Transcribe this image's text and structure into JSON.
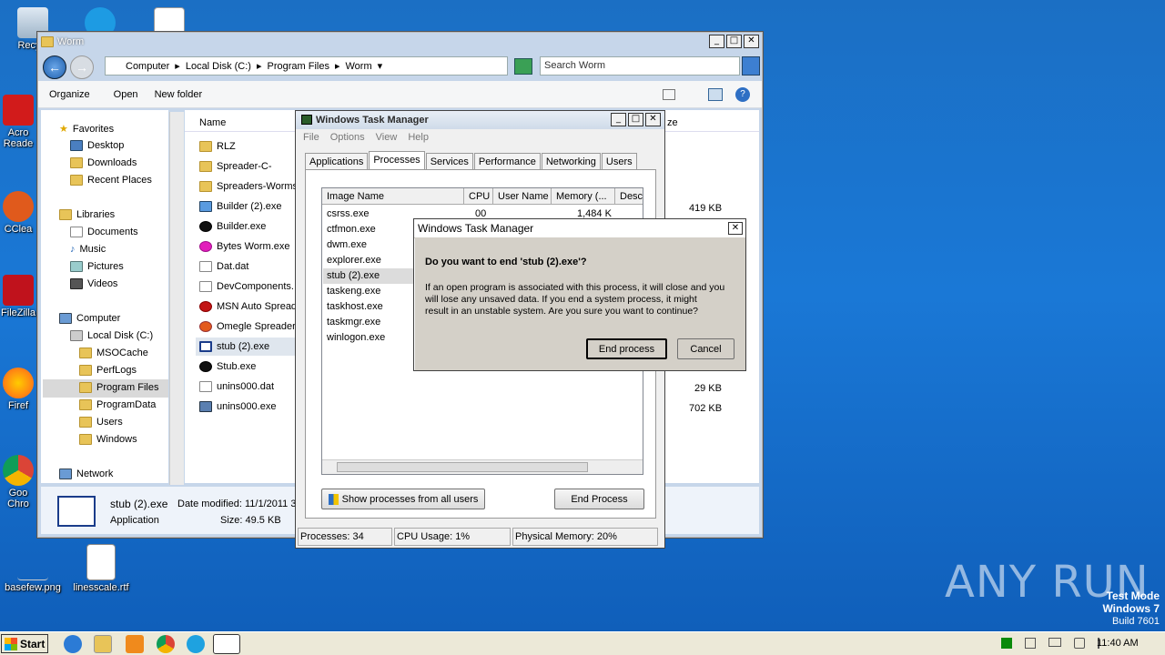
{
  "desktop": {
    "icons": {
      "recycle": "Recycl",
      "acrobat": "Acro Reade",
      "ccleaner": "CClea",
      "filezilla": "FileZilla",
      "firefox": "Firef",
      "chrome": "Goo Chro",
      "basefew": "basefew.png",
      "linesscale": "linesscale.rtf"
    },
    "watermark": "ANY RUN",
    "test_mode": {
      "line1": "Test Mode",
      "line2": "Windows 7",
      "line3": "Build 7601"
    }
  },
  "explorer": {
    "title": "Worm",
    "breadcrumbs": [
      "Computer",
      "Local Disk (C:)",
      "Program Files",
      "Worm"
    ],
    "search_placeholder": "Search Worm",
    "toolbar": {
      "organize": "Organize",
      "open": "Open",
      "new_folder": "New folder"
    },
    "column_name": "Name",
    "column_size": "ze",
    "nav": {
      "favorites": "Favorites",
      "desktop": "Desktop",
      "downloads": "Downloads",
      "recent": "Recent Places",
      "libraries": "Libraries",
      "documents": "Documents",
      "music": "Music",
      "pictures": "Pictures",
      "videos": "Videos",
      "computer": "Computer",
      "local_disk": "Local Disk (C:)",
      "msocache": "MSOCache",
      "perflogs": "PerfLogs",
      "program_files": "Program Files",
      "programdata": "ProgramData",
      "users": "Users",
      "windows": "Windows",
      "network": "Network"
    },
    "files": [
      {
        "name": "RLZ",
        "size": ""
      },
      {
        "name": "Spreader-C-",
        "size": ""
      },
      {
        "name": "Spreaders-Worms",
        "size": ""
      },
      {
        "name": "Builder (2).exe",
        "size": "419 KB"
      },
      {
        "name": "Builder.exe",
        "size": ""
      },
      {
        "name": "Bytes Worm.exe",
        "size": ""
      },
      {
        "name": "Dat.dat",
        "size": ""
      },
      {
        "name": "DevComponents.",
        "size": ""
      },
      {
        "name": "MSN Auto Spread",
        "size": ""
      },
      {
        "name": "Omegle Spreader",
        "size": ""
      },
      {
        "name": "stub (2).exe",
        "size": ""
      },
      {
        "name": "Stub.exe",
        "size": ""
      },
      {
        "name": "unins000.dat",
        "size": "29 KB"
      },
      {
        "name": "unins000.exe",
        "size": "702 KB"
      }
    ],
    "details": {
      "name": "stub (2).exe",
      "modified": "Date modified: 11/1/2011 3",
      "type": "Application",
      "size": "Size: 49.5 KB"
    }
  },
  "taskmgr": {
    "title": "Windows Task Manager",
    "menu": [
      "File",
      "Options",
      "View",
      "Help"
    ],
    "tabs": [
      "Applications",
      "Processes",
      "Services",
      "Performance",
      "Networking",
      "Users"
    ],
    "columns": [
      "Image Name",
      "CPU",
      "User Name",
      "Memory (...",
      "Desc"
    ],
    "processes": [
      {
        "name": "csrss.exe",
        "cpu": "00",
        "mem": "1,484 K"
      },
      {
        "name": "ctfmon.exe",
        "cpu": "",
        "mem": ""
      },
      {
        "name": "dwm.exe",
        "cpu": "",
        "mem": ""
      },
      {
        "name": "explorer.exe",
        "cpu": "",
        "mem": ""
      },
      {
        "name": "stub (2).exe",
        "cpu": "",
        "mem": ""
      },
      {
        "name": "taskeng.exe",
        "cpu": "",
        "mem": ""
      },
      {
        "name": "taskhost.exe",
        "cpu": "",
        "mem": ""
      },
      {
        "name": "taskmgr.exe",
        "cpu": "",
        "mem": ""
      },
      {
        "name": "winlogon.exe",
        "cpu": "",
        "mem": ""
      }
    ],
    "show_all": "Show processes from all users",
    "end_process": "End Process",
    "status": {
      "processes": "Processes: 34",
      "cpu": "CPU Usage: 1%",
      "memory": "Physical Memory: 20%"
    }
  },
  "dialog": {
    "title": "Windows Task Manager",
    "question": "Do you want to end 'stub (2).exe'?",
    "line1": "If an open program is associated with this process, it will close and you",
    "line2": "will lose any unsaved data. If you end a system process, it might",
    "line3": "result in an unstable system. Are you sure you want to continue?",
    "end_btn": "End process",
    "cancel_btn": "Cancel"
  },
  "taskbar": {
    "start": "Start",
    "clock": "11:40 AM"
  }
}
